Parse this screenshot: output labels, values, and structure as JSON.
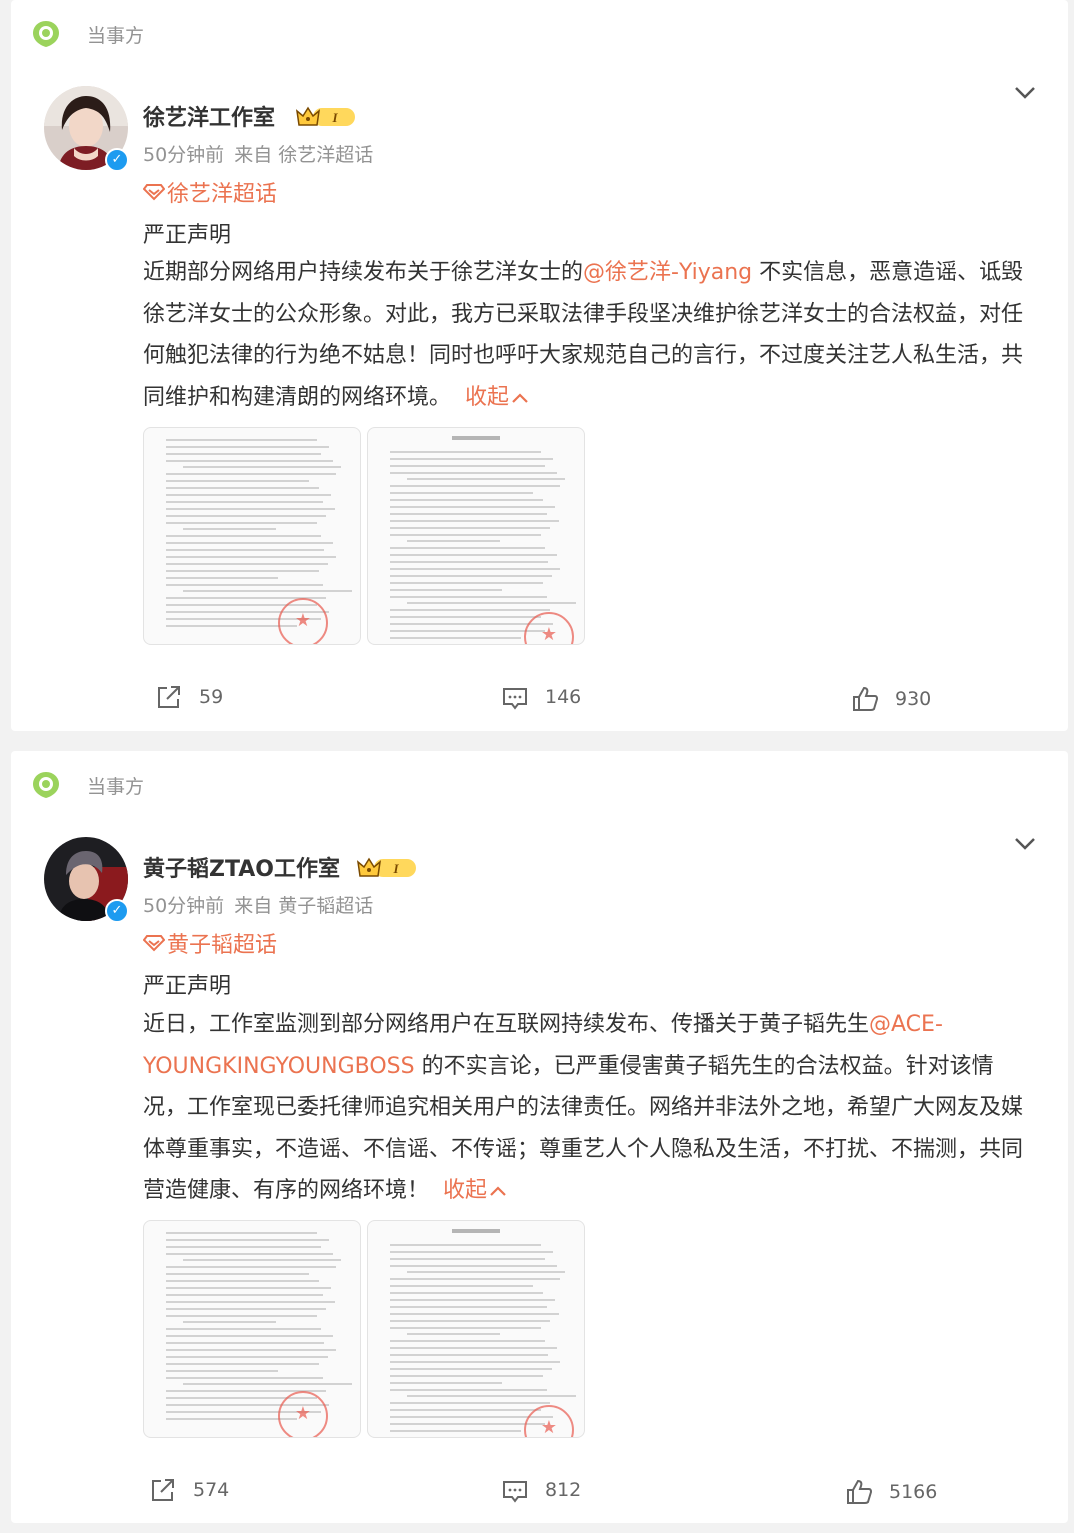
{
  "posts": [
    {
      "party_label": "当事方",
      "author": "徐艺洋工作室",
      "vip_level": "I",
      "time": "50分钟前",
      "source": "来自 徐艺洋超话",
      "topic": "徐艺洋超话",
      "title": "严正声明",
      "body_before": "近期部分网络用户持续发布关于徐艺洋女士的",
      "mention": "@徐艺洋-Yiyang",
      "body_after": " 不实信息，恶意造谣、诋毁徐艺洋女士的公众形象。对此，我方已采取法律手段坚决维护徐艺洋女士的合法权益，对任何触犯法律的行为绝不姑息！同时也呼吁大家规范自己的言行，不过度关注艺人私生活，共同维护和构建清朗的网络环境。",
      "collapse_label": "收起",
      "repost_count": "59",
      "comment_count": "146",
      "like_count": "930"
    },
    {
      "party_label": "当事方",
      "author": "黄子韬ZTAO工作室",
      "vip_level": "I",
      "time": "50分钟前",
      "source": "来自 黄子韬超话",
      "topic": "黄子韬超话",
      "title": "严正声明",
      "body_before": "近日，工作室监测到部分网络用户在互联网持续发布、传播关于黄子韬先生",
      "mention": "@ACE-YOUNGKINGYOUNGBOSS",
      "body_after": " 的不实言论，已严重侵害黄子韬先生的合法权益。针对该情况，工作室现已委托律师追究相关用户的法律责任。网络并非法外之地，希望广大网友及媒体尊重事实，不造谣、不信谣、不传谣；尊重艺人个人隐私及生活，不打扰、不揣测，共同营造健康、有序的网络环境！",
      "collapse_label": "收起",
      "repost_count": "574",
      "comment_count": "812",
      "like_count": "5166"
    }
  ],
  "colors": {
    "accent": "#eb7350",
    "muted": "#939393",
    "verify": "#1d9bf0"
  }
}
